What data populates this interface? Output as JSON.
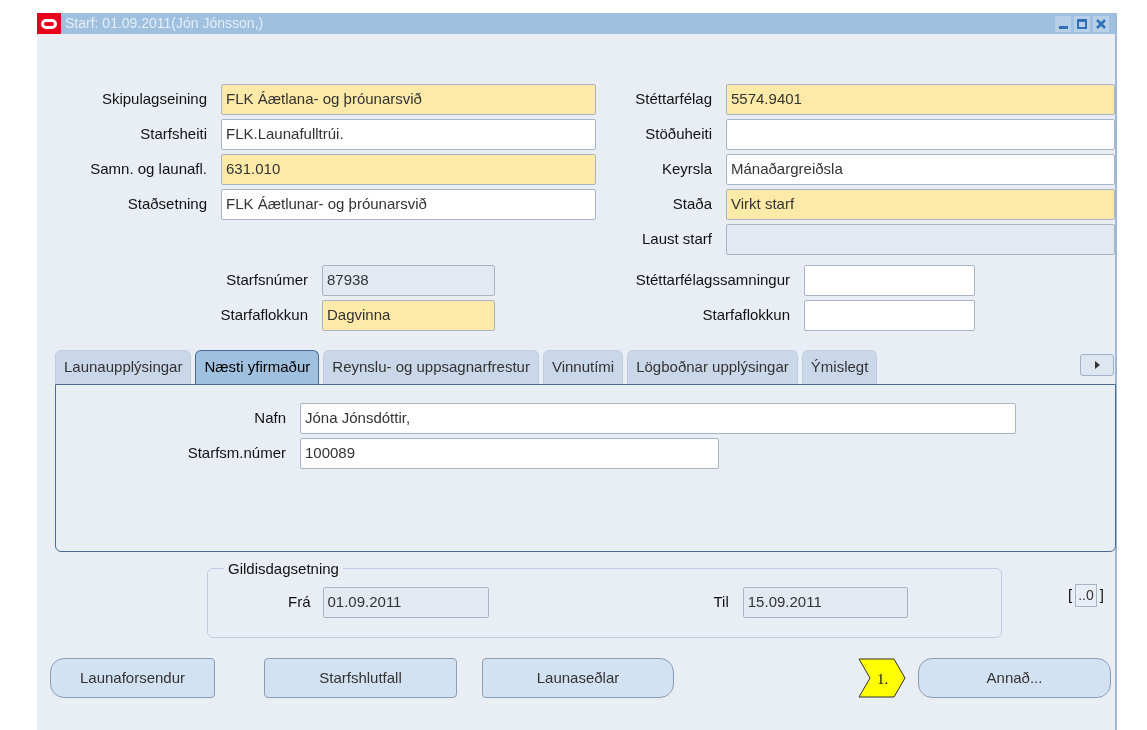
{
  "window": {
    "title": "Starf: 01.09.2011(Jón Jónsson,)"
  },
  "left_fields": [
    {
      "label": "Skipulagseining",
      "value": "FLK Áætlana- og þróunarsvið",
      "kind": "required"
    },
    {
      "label": "Starfsheiti",
      "value": "FLK.Launafulltrúi.",
      "kind": "text"
    },
    {
      "label": "Samn. og launafl.",
      "value": "631.010",
      "kind": "required"
    },
    {
      "label": "Staðsetning",
      "value": "FLK Áætlunar- og þróunarsvið",
      "kind": "text"
    }
  ],
  "right_fields": [
    {
      "label": "Stéttarfélag",
      "value": "5574.9401",
      "kind": "required"
    },
    {
      "label": "Stöðuheiti",
      "kind": "text"
    },
    {
      "label": "Keyrsla",
      "value": "Mánaðargreiðsla",
      "kind": "text"
    },
    {
      "label": "Staða",
      "value": "Virkt starf",
      "kind": "required"
    },
    {
      "label": "Laust starf",
      "kind": "readonly"
    }
  ],
  "mid_left_fields": [
    {
      "label": "Starfsnúmer",
      "value": "87938",
      "kind": "readonly"
    },
    {
      "label": "Starfaflokkun",
      "value": "Dagvinna",
      "kind": "required"
    }
  ],
  "mid_right_fields": [
    {
      "label": "Stéttarfélagssamningur",
      "kind": "text"
    },
    {
      "label": "Starfaflokkun",
      "kind": "text"
    }
  ],
  "tabs": [
    {
      "label": "Launaupplýsingar",
      "selected": false
    },
    {
      "label": "Næsti yfirmaður",
      "selected": true
    },
    {
      "label": "Reynslu- og uppsagnarfrestur",
      "selected": false
    },
    {
      "label": "Vinnutími",
      "selected": false
    },
    {
      "label": "Lögboðnar upplýsingar",
      "selected": false
    },
    {
      "label": "Ýmislegt",
      "selected": false
    }
  ],
  "tab_panel": {
    "fields": [
      {
        "label": "Nafn",
        "value": "Jóna Jónsdóttir,",
        "kind": "text"
      },
      {
        "label": "Starfsm.númer",
        "value": "100089",
        "kind": "text"
      }
    ]
  },
  "validity": {
    "title": "Gildisdagsetning",
    "from": {
      "label": "Frá",
      "value": "01.09.2011",
      "kind": "readonly"
    },
    "to": {
      "label": "Til",
      "value": "15.09.2011",
      "kind": "readonly"
    }
  },
  "record_indicator": {
    "open": "[",
    "value": "..0",
    "close": "]"
  },
  "buttons": [
    "Launaforsendur",
    "Starfshlutfall",
    "Launaseðlar"
  ],
  "callout": "1.",
  "other_button": "Annað..."
}
